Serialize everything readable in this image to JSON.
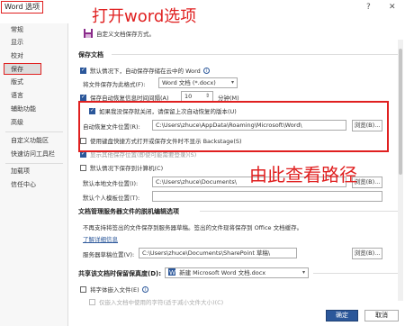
{
  "window": {
    "title": "Word 选项",
    "help": "?",
    "close": "✕"
  },
  "sidebar": {
    "items": [
      "常规",
      "显示",
      "校对",
      "保存",
      "版式",
      "语言",
      "辅助功能",
      "高级",
      "自定义功能区",
      "快速访问工具栏",
      "加载项",
      "信任中心"
    ],
    "active": "保存"
  },
  "header": {
    "desc": "自定义文档保存方式。"
  },
  "sections": {
    "save_docs": "保存文档",
    "offline": "文档管理服务器文件的脱机编辑选项",
    "share_fidelity": "共享该文档时保留保真度(D):"
  },
  "save": {
    "autosave_label": "默认情况下，自动保存存储在云中的 Word",
    "format_label": "将文件保存为此格式(F):",
    "format_value": "Word 文档 (*.docx)",
    "interval_label": "保存自动恢复信息时间间隔(A)",
    "interval_value": "10",
    "interval_unit": "分钟(M)",
    "keep_last_label": "如果我没保存就关闭，请保留上次自动恢复的版本(U)",
    "autorecover_label": "自动恢复文件位置(R):",
    "autorecover_path": "C:\\Users\\zhuce\\AppData\\Roaming\\Microsoft\\Word\\",
    "browse1": "浏览(B)...",
    "backstage_label": "使用键盘快捷方式打开或保存文件时不显示 Backstage(S)",
    "show_more_label": "显示其他保存位置(即使可能需要登录)(S)",
    "default_computer_label": "默认情况下保存到计算机(C)",
    "local_location_label": "默认本地文件位置(I):",
    "local_location_path": "C:\\Users\\zhuce\\Documents\\",
    "browse2": "浏览(B)...",
    "template_label": "默认个人模板位置(T):"
  },
  "offline": {
    "note": "不再支持将签出的文件保存到服务器草稿。签出的文件现将保存到 Office 文档缓存。",
    "learn_more": "了解详细信息",
    "draft_label": "服务器草稿位置(V):",
    "draft_path": "C:\\Users\\zhuce\\Documents\\SharePoint 草稿\\",
    "browse3": "浏览(B)..."
  },
  "fidelity": {
    "doc_value": "新建 Microsoft Word 文档.docx",
    "embed_fonts_label": "将字体嵌入文件(E)",
    "embed_used_label": "仅嵌入文档中使用的字符(适于减小文件大小)(C)"
  },
  "annotations": {
    "top": "打开word选项",
    "middle": "由此查看路径"
  },
  "footer": {
    "ok": "确定",
    "cancel": "取消"
  },
  "colors": {
    "accent": "#2b579a",
    "annotation": "#e02020"
  }
}
